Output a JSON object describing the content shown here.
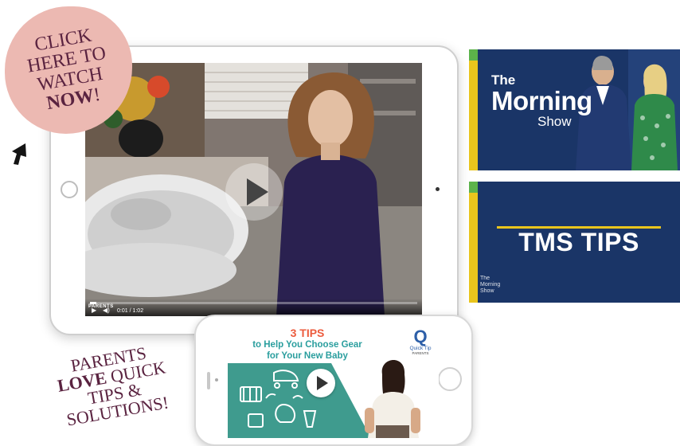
{
  "cta": {
    "line1": "CLICK",
    "line2": "HERE TO",
    "line3": "WATCH",
    "line4_bold": "NOW",
    "line4_suffix": "!"
  },
  "tablet_video": {
    "brand": "PARENTS",
    "time": "0:01 / 1:02",
    "progress": 0.02
  },
  "tv_panel_1": {
    "logo_the": "The",
    "logo_morning": "Morning",
    "logo_show": "Show"
  },
  "tv_panel_2": {
    "title": "TMS TIPS",
    "mini_logo_line1": "The",
    "mini_logo_line2": "Morning",
    "mini_logo_line3": "Show"
  },
  "phone_video": {
    "tips": "3 TIPS",
    "line1": "to Help You Choose Gear",
    "line2": "for Your New Baby",
    "badge_letter": "Q",
    "badge_label": "Quick Tip",
    "badge_sub": "PARENTS"
  },
  "callout": {
    "line1": "PARENTS",
    "line2_bold": "LOVE",
    "line2_rest": " QUICK",
    "line3": "TIPS &",
    "line4": "SOLUTIONS!"
  },
  "colors": {
    "cta_pink": "#ecb9b2",
    "plum_text": "#5a2340",
    "tv_navy": "#1a3567",
    "accent_yellow": "#e9c51d",
    "accent_green": "#5cb34a",
    "teal": "#3f9b8e",
    "tips_orange": "#ec5b3d"
  },
  "icons": {
    "arrow": "cursor-arrow-icon",
    "play": "play-icon"
  }
}
